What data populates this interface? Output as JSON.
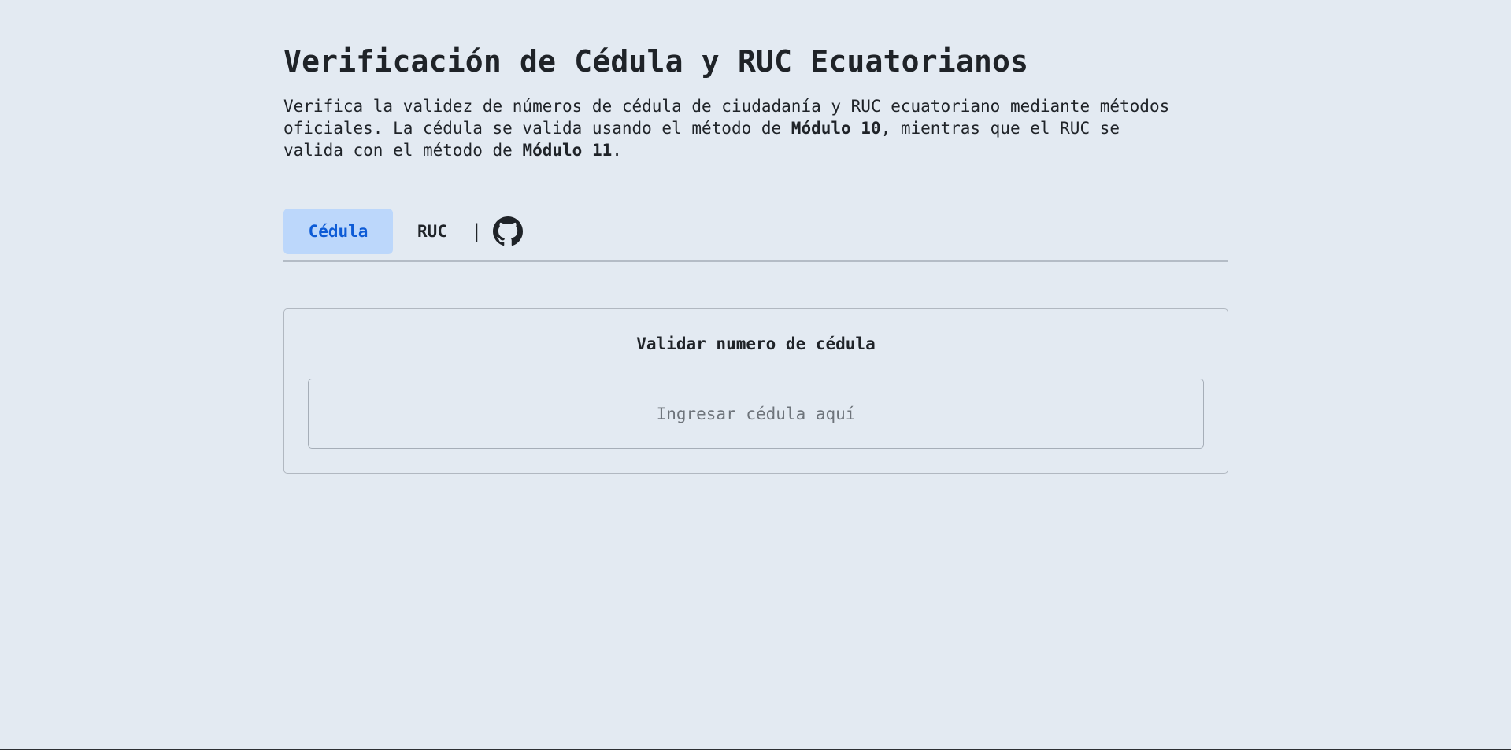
{
  "header": {
    "title": "Verificación de Cédula y RUC Ecuatorianos",
    "description": {
      "line1": "Verifica la validez de números de cédula de ciudadanía y RUC ecuatoriano mediante métodos",
      "line2_before": "oficiales. La cédula se valida usando el método de ",
      "line2_bold": "Módulo 10",
      "line2_after": ", mientras que el RUC se",
      "line3_before": "valida con el método de ",
      "line3_bold": "Módulo 11",
      "line3_after": "."
    }
  },
  "tabs": {
    "items": [
      {
        "label": "Cédula",
        "active": true
      },
      {
        "label": "RUC",
        "active": false
      }
    ],
    "separator": "|",
    "github_icon": "github-icon"
  },
  "form": {
    "title": "Validar numero de cédula",
    "input_placeholder": "Ingresar cédula aquí",
    "input_value": ""
  },
  "colors": {
    "background": "#e3eaf2",
    "active_tab_bg": "#bcd7fb",
    "active_tab_text": "#0d5bd6",
    "text": "#1f2328",
    "border": "#b1b8c1"
  }
}
